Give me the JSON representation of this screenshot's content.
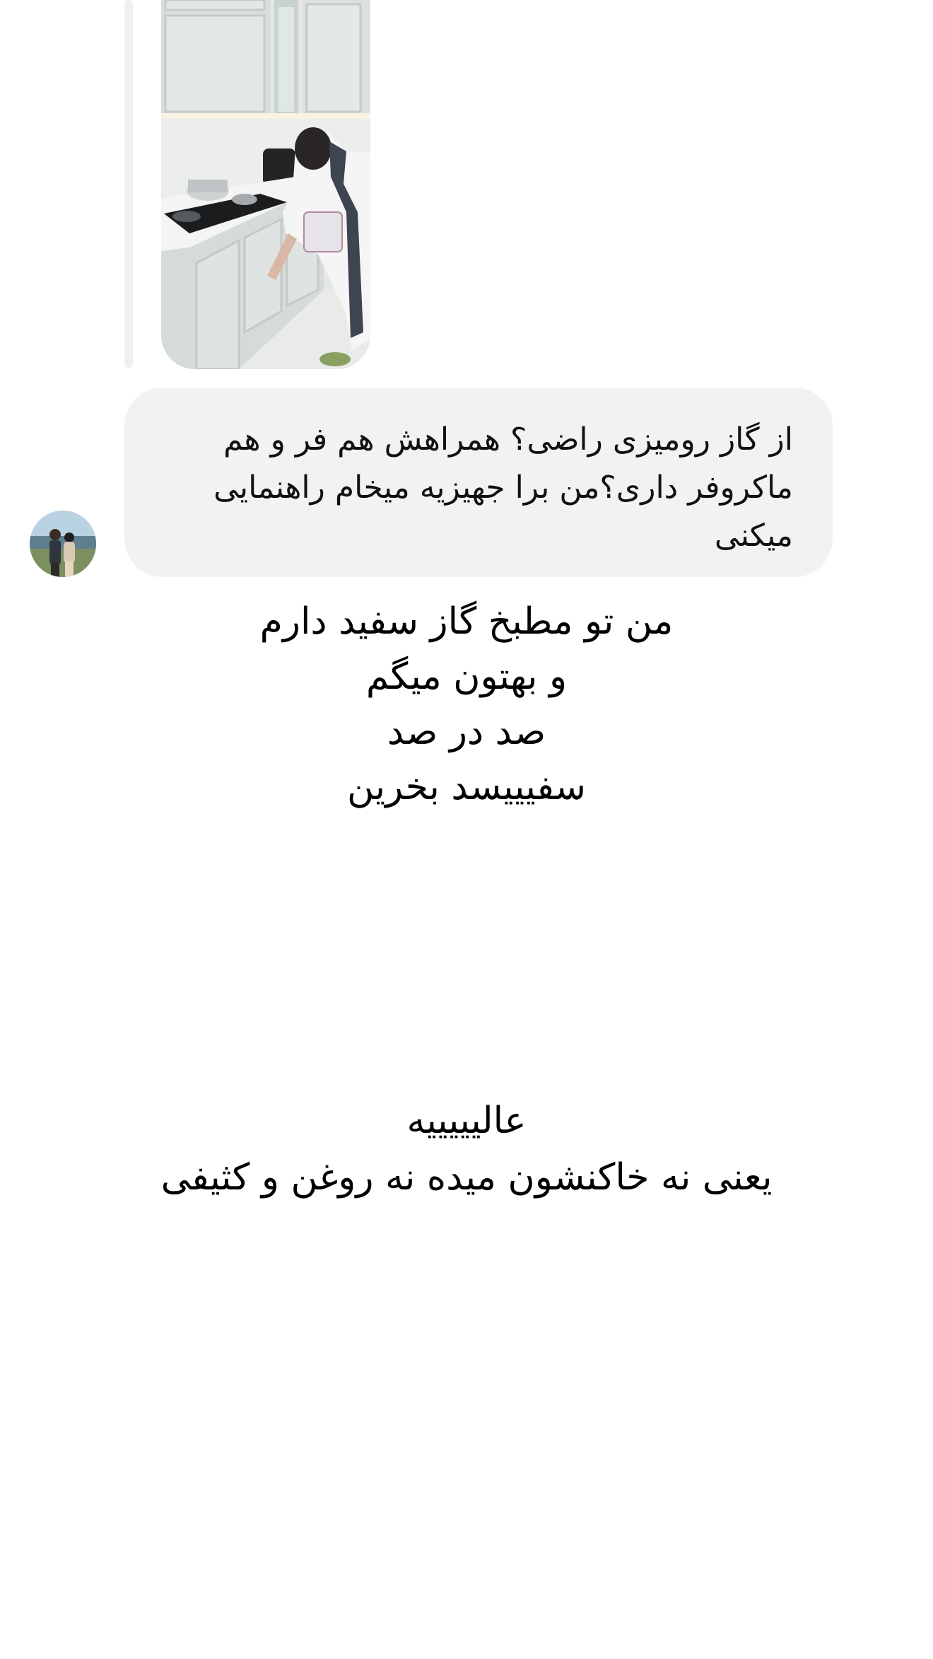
{
  "shared_post": {
    "icon": "kitchen-photo"
  },
  "comment": {
    "avatar_icon": "couple-photo-avatar",
    "text": "از گاز رومیزی راضی؟ همراهش هم فر و هم ماکروفر داری؟من برا جهیزیه میخام راهنمایی میکنی",
    "bubble_color": "#f1f2f4"
  },
  "story_caption_1": {
    "lines": [
      "من تو مطبخ گاز سفید دارم",
      "و بهتون میگم",
      "صد در صد",
      "سفیییسد بخرین"
    ]
  },
  "story_caption_2": {
    "lines": [
      "عالیییییه",
      "یعنی نه خاکنشون میده نه روغن و کثیفی"
    ]
  }
}
